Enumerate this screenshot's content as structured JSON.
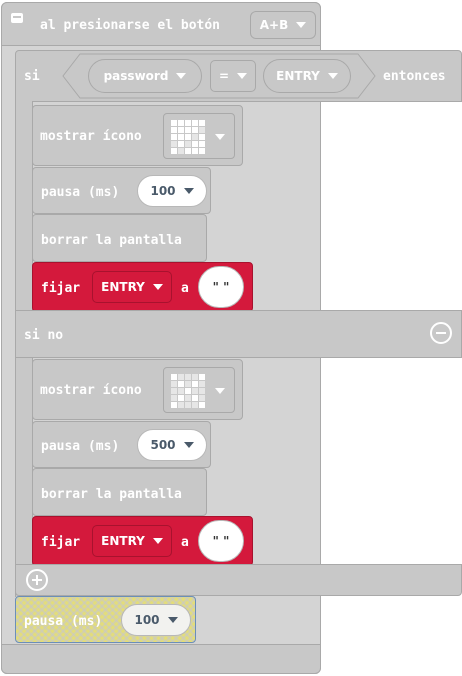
{
  "event": {
    "label": "al presionarse el botón",
    "button": "A+B"
  },
  "if_block": {
    "si": "si",
    "entonces": "entonces",
    "sino": "si no",
    "condition": {
      "left": "password",
      "operator": "=",
      "right": "ENTRY"
    }
  },
  "then_branch": {
    "show_icon_label": "mostrar ícono",
    "pause_label": "pausa (ms)",
    "pause_value": "100",
    "clear_label": "borrar la pantalla",
    "set_label": "fijar",
    "set_var": "ENTRY",
    "set_to": "a",
    "set_value": "\" \""
  },
  "else_branch": {
    "show_icon_label": "mostrar ícono",
    "pause_label": "pausa (ms)",
    "pause_value": "500",
    "clear_label": "borrar la pantalla",
    "set_label": "fijar",
    "set_var": "ENTRY",
    "set_to": "a",
    "set_value": "\" \""
  },
  "after_if": {
    "pause_label": "pausa (ms)",
    "pause_value": "100"
  },
  "icons": {
    "then_icon": "checkmark-led-icon",
    "else_icon": "x-led-icon"
  },
  "colors": {
    "block_grey": "#c8c8c8",
    "variable_red": "#d4193c",
    "disabled_yellow": "#e7e07f"
  }
}
